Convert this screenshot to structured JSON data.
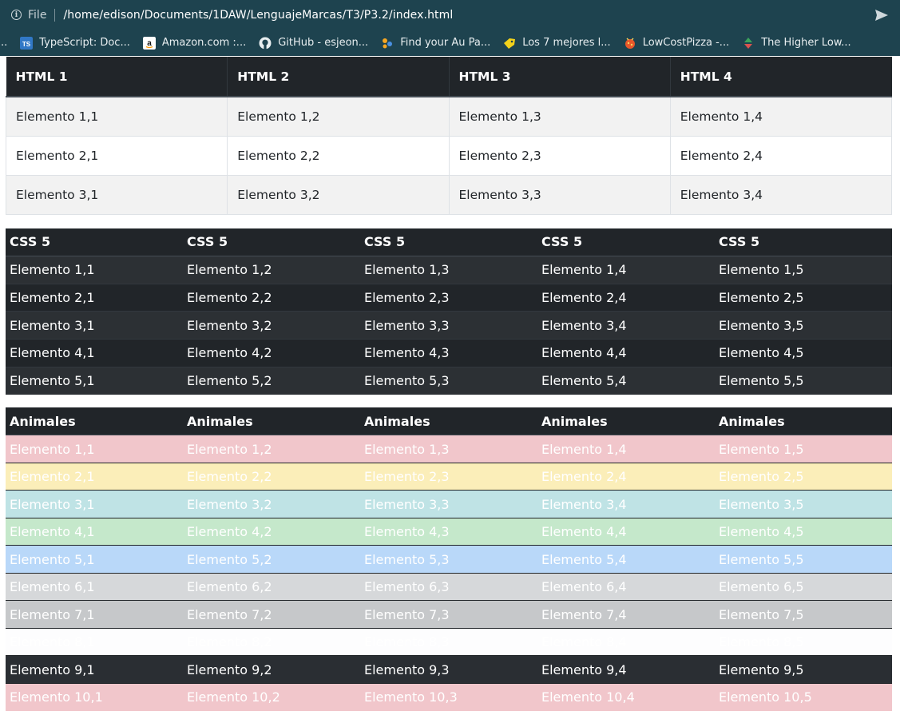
{
  "browser": {
    "file_label": "File",
    "url": "/home/edison/Documents/1DAW/LenguajeMarcas/T3/P3.2/index.html",
    "bookmarks_lead": "..",
    "bookmarks": [
      {
        "label": "TypeScript: Doc...",
        "icon": "typescript-icon",
        "color": "#3178c6"
      },
      {
        "label": "Amazon.com :...",
        "icon": "amazon-icon",
        "color": "#ffffff"
      },
      {
        "label": "GitHub - esjeon...",
        "icon": "github-icon",
        "color": "#e8eef0"
      },
      {
        "label": "Find your Au Pa...",
        "icon": "aupair-icon",
        "color": "#f5a623"
      },
      {
        "label": "Los 7 mejores l...",
        "icon": "tag-icon",
        "color": "#f2d21b"
      },
      {
        "label": "LowCostPizza -...",
        "icon": "pizza-icon",
        "color": "#e8572a"
      },
      {
        "label": "The Higher Low...",
        "icon": "updown-icon",
        "color": "#3aa35b"
      }
    ]
  },
  "table1": {
    "headers": [
      "HTML 1",
      "HTML 2",
      "HTML 3",
      "HTML 4"
    ],
    "rows": [
      [
        "Elemento 1,1",
        "Elemento 1,2",
        "Elemento 1,3",
        "Elemento 1,4"
      ],
      [
        "Elemento 2,1",
        "Elemento 2,2",
        "Elemento 2,3",
        "Elemento 2,4"
      ],
      [
        "Elemento 3,1",
        "Elemento 3,2",
        "Elemento 3,3",
        "Elemento 3,4"
      ]
    ]
  },
  "table2": {
    "headers": [
      "CSS 5",
      "CSS 5",
      "CSS 5",
      "CSS 5",
      "CSS 5"
    ],
    "rows": [
      [
        "Elemento 1,1",
        "Elemento 1,2",
        "Elemento 1,3",
        "Elemento 1,4",
        "Elemento 1,5"
      ],
      [
        "Elemento 2,1",
        "Elemento 2,2",
        "Elemento 2,3",
        "Elemento 2,4",
        "Elemento 2,5"
      ],
      [
        "Elemento 3,1",
        "Elemento 3,2",
        "Elemento 3,3",
        "Elemento 3,4",
        "Elemento 3,5"
      ],
      [
        "Elemento 4,1",
        "Elemento 4,2",
        "Elemento 4,3",
        "Elemento 4,4",
        "Elemento 4,5"
      ],
      [
        "Elemento 5,1",
        "Elemento 5,2",
        "Elemento 5,3",
        "Elemento 5,4",
        "Elemento 5,5"
      ]
    ]
  },
  "table3": {
    "headers": [
      "Animales",
      "Animales",
      "Animales",
      "Animales",
      "Animales"
    ],
    "row_colors": [
      "#f1c6cb",
      "#fbeeb9",
      "#bfe3e5",
      "#c5e8cb",
      "#b9d8f9",
      "#d6d8da",
      "#c6c8ca",
      "#fdfdfe",
      "#2a2e33",
      "#f1c6cb"
    ],
    "rows": [
      [
        "Elemento 1,1",
        "Elemento 1,2",
        "Elemento 1,3",
        "Elemento 1,4",
        "Elemento 1,5"
      ],
      [
        "Elemento 2,1",
        "Elemento 2,2",
        "Elemento 2,3",
        "Elemento 2,4",
        "Elemento 2,5"
      ],
      [
        "Elemento 3,1",
        "Elemento 3,2",
        "Elemento 3,3",
        "Elemento 3,4",
        "Elemento 3,5"
      ],
      [
        "Elemento 4,1",
        "Elemento 4,2",
        "Elemento 4,3",
        "Elemento 4,4",
        "Elemento 4,5"
      ],
      [
        "Elemento 5,1",
        "Elemento 5,2",
        "Elemento 5,3",
        "Elemento 5,4",
        "Elemento 5,5"
      ],
      [
        "Elemento 6,1",
        "Elemento 6,2",
        "Elemento 6,3",
        "Elemento 6,4",
        "Elemento 6,5"
      ],
      [
        "Elemento 7,1",
        "Elemento 7,2",
        "Elemento 7,3",
        "Elemento 7,4",
        "Elemento 7,5"
      ],
      [
        "Elemento 8,1",
        "Elemento 8,2",
        "Elemento 8,3",
        "Elemento 8,4",
        "Elemento 8,5"
      ],
      [
        "Elemento 9,1",
        "Elemento 9,2",
        "Elemento 9,3",
        "Elemento 9,4",
        "Elemento 9,5"
      ],
      [
        "Elemento 10,1",
        "Elemento 10,2",
        "Elemento 10,3",
        "Elemento 10,4",
        "Elemento 10,5"
      ]
    ]
  }
}
